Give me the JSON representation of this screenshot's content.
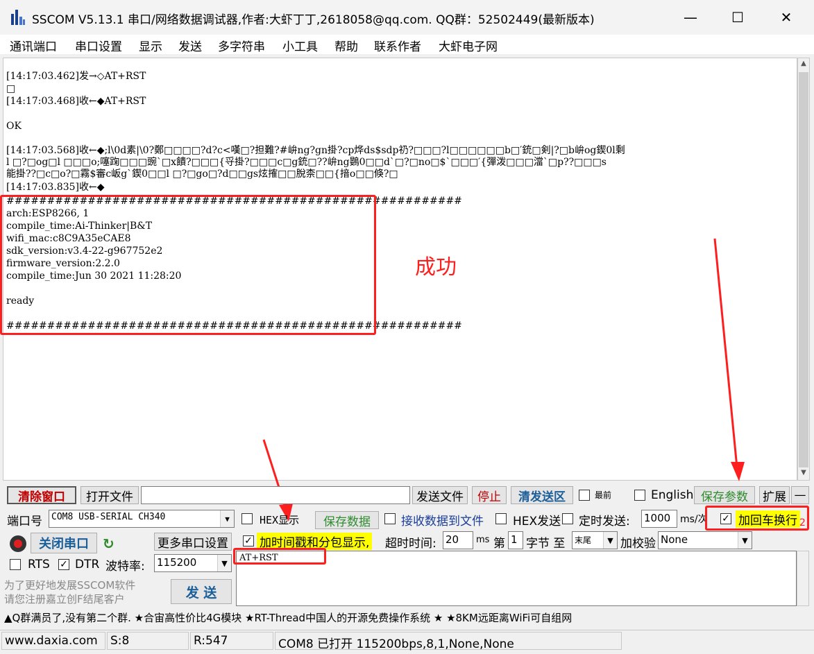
{
  "window": {
    "title": "SSCOM V5.13.1 串口/网络数据调试器,作者:大虾丁丁,2618058@qq.com. QQ群：52502449(最新版本)",
    "minimize": "—",
    "maximize": "☐",
    "close": "✕"
  },
  "menu": [
    "通讯端口",
    "串口设置",
    "显示",
    "发送",
    "多字符串",
    "小工具",
    "帮助",
    "联系作者",
    "大虾电子网"
  ],
  "terminal": {
    "lines": [
      "[14:17:03.462]发→◇AT+RST",
      "□",
      "[14:17:03.468]收←◆AT+RST",
      "",
      "OK",
      "",
      "[14:17:03.568]收←◆;l\\0d素|\\0?鄭□□□□?d?c<嘆□?担難?#峅ng?gn掛?cp烨ds$sdp礽?□□□?l□□□□□□b□′銃□剣|?□b峅og鍥0l剩",
      "l □?□og□l □□□o;噻踘□□□豌`□x饋?□□□{寽掛?□□□c□g銃□??峅ng鷃0□□d`□?□no□$`□□□′{彈泼□□□澢`□p??□□□s",
      "能掛??□c□o?□霧$審c岅g`鍥0□□l □?□go□?d□□gs炫搉□□脫柰□□{揞o□□倏?□",
      "[14:17:03.835]收←◆",
      "########################################################",
      "arch:ESP8266, 1",
      "compile_time:Ai-Thinker|B&T",
      "wifi_mac:c8C9A35eCAE8",
      "sdk_version:v3.4-22-g967752e2",
      "firmware_version:2.2.0",
      "compile_time:Jun 30 2021 11:28:20",
      "",
      "ready",
      "",
      "########################################################"
    ]
  },
  "annotation": {
    "success_text": "成功",
    "arrow_number": "2"
  },
  "row1": {
    "clear_window": "清除窗口",
    "open_file": "打开文件",
    "send_file": "发送文件",
    "stop": "停止",
    "clear_send": "清发送区",
    "topmost": "最前",
    "english": "English",
    "save_params": "保存参数",
    "expand": "扩展",
    "collapse": "—"
  },
  "row2": {
    "port_label": "端口号",
    "port_value": "COM8 USB-SERIAL CH340",
    "hex_display": "HEX显示",
    "save_data": "保存数据",
    "recv_to_file": "接收数据到文件",
    "hex_send": "HEX发送",
    "timed_send": "定时发送:",
    "interval": "1000",
    "interval_unit": "ms/次",
    "add_crlf": "加回车换行"
  },
  "row3": {
    "close_port": "关闭串口",
    "more_settings": "更多串口设置",
    "timestamp": "加时间戳和分包显示,",
    "timeout_label": "超时时间:",
    "timeout_value": "20",
    "timeout_unit": "ms",
    "nth_label": "第",
    "nth_value": "1",
    "byte_to": "字节 至",
    "end_value": "末尾",
    "checksum_label": "加校验",
    "checksum_value": "None"
  },
  "row4": {
    "rts": "RTS",
    "dtr": "DTR",
    "baud_label": "波特率:",
    "baud_value": "115200",
    "send_text": "AT+RST"
  },
  "promo": {
    "line1": "为了更好地发展SSCOM软件",
    "line2": "请您注册嘉立创F结尾客户",
    "send_button": "发  送"
  },
  "ticker": "▲Q群满员了,没有第二个群. ★合宙高性价比4G模块 ★RT-Thread中国人的开源免费操作系统 ★ ★8KM远距离WiFi可自组网",
  "status": {
    "site": "www.daxia.com",
    "sent": "S:8",
    "received": "R:547",
    "port_status": "COM8 已打开  115200bps,8,1,None,None"
  },
  "colors": {
    "accent_red": "#ff1e1e",
    "highlight_yellow": "#ffff00",
    "save_green": "#2e8b2e"
  }
}
